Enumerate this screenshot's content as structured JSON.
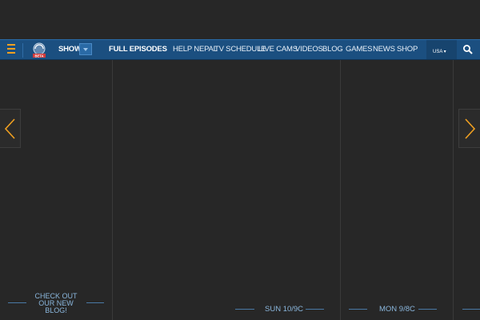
{
  "nav": {
    "shows_label": "SHOWS",
    "full_episodes_label": "FULL EPISODES",
    "links": [
      "HELP NEPAL",
      "TV SCHEDULE",
      "LIVE CAMS",
      "VIDEOS",
      "BLOG",
      "GAMES",
      "NEWS",
      "SHOP"
    ],
    "region": "USA",
    "logo_badge": "BETA",
    "accent_color": "#f0a020",
    "bar_color": "#1b4f80"
  },
  "promos": [
    {
      "lines": [
        "CHECK OUT",
        "OUR NEW",
        "BLOG!"
      ]
    }
  ],
  "schedule": [
    {
      "time": "SUN 10/9C"
    },
    {
      "time": "MON 9/8C"
    }
  ],
  "icons": [
    "hamburger-icon",
    "discovery-logo",
    "chevron-down-icon",
    "search-icon",
    "arrow-left-icon",
    "arrow-right-icon"
  ]
}
